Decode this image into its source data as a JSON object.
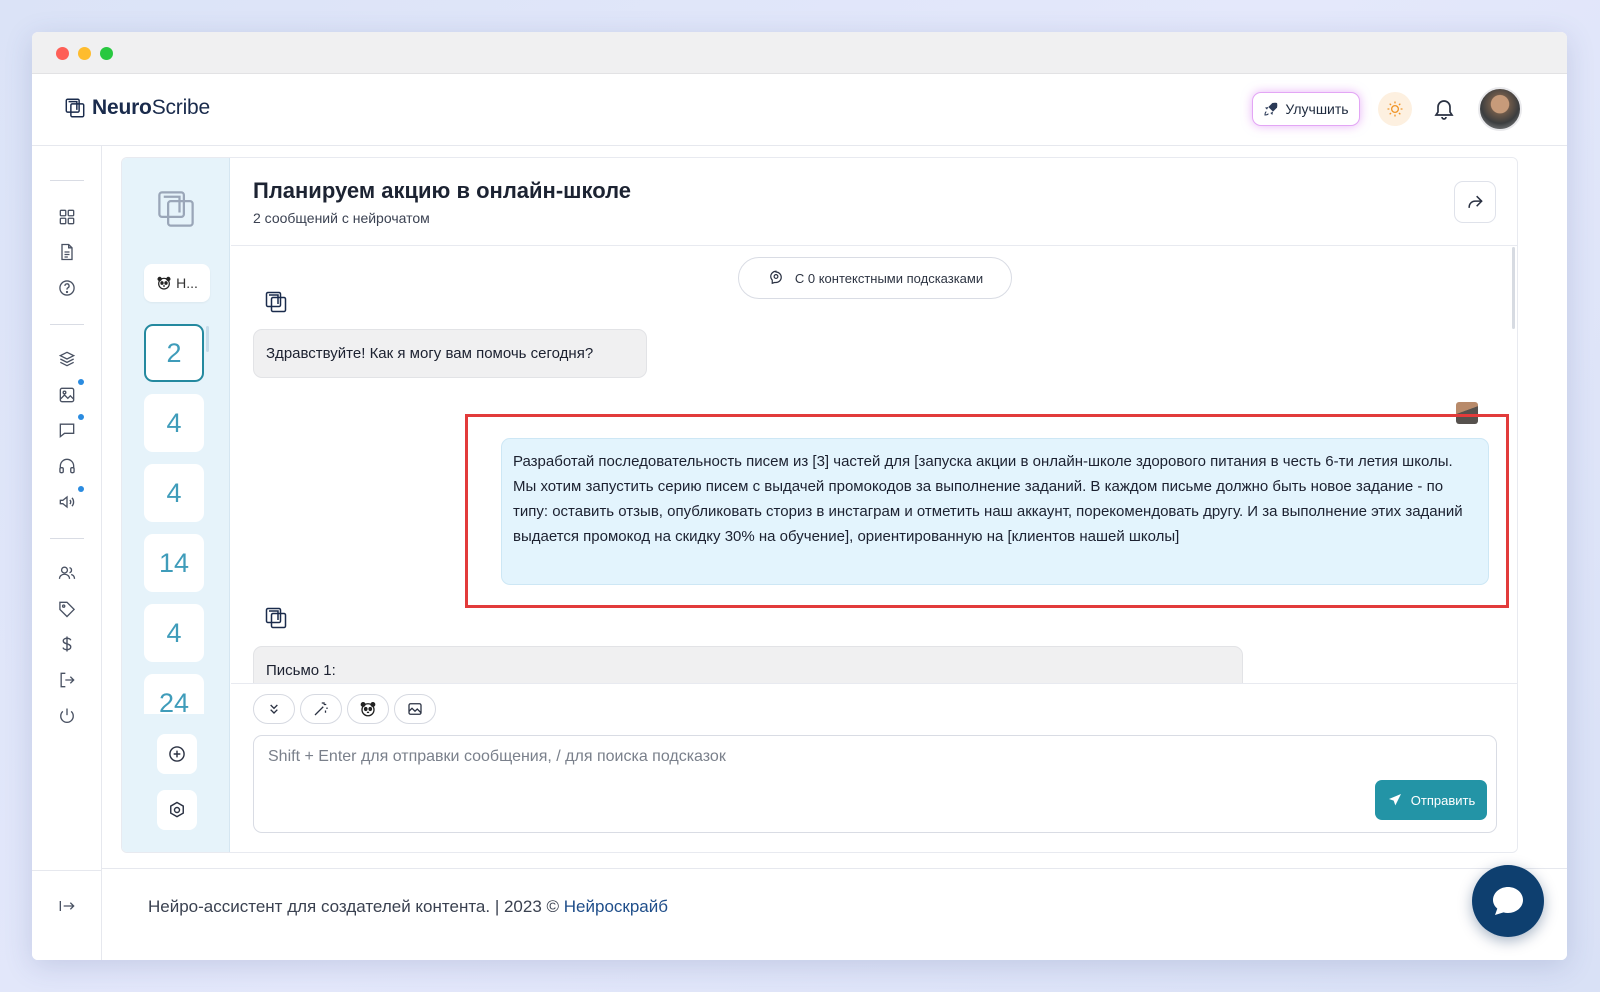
{
  "app": {
    "brand_bold": "Neuro",
    "brand_regular": "Scribe"
  },
  "header": {
    "upgrade_label": "Улучшить",
    "icons": [
      "sun-icon",
      "bell-icon",
      "avatar"
    ]
  },
  "sidebar_icons": [
    "dashboard-icon",
    "document-icon",
    "help-icon",
    "layers-icon",
    "image-icon",
    "chat-icon",
    "headphones-icon",
    "megaphone-icon",
    "users-icon",
    "tag-icon",
    "dollar-icon",
    "logout-icon",
    "power-icon",
    "collapse-icon"
  ],
  "prompt_panel": {
    "selector_label": "Н...",
    "counts": [
      "2",
      "4",
      "4",
      "14",
      "4",
      "24"
    ],
    "active_index": 0
  },
  "chat": {
    "title": "Планируем акцию в онлайн-школе",
    "subtitle": "2 сообщений с нейрочатом",
    "context_pill": "С 0 контекстными подсказками",
    "messages": [
      {
        "role": "bot",
        "text": "Здравствуйте! Как я могу вам помочь сегодня?"
      },
      {
        "role": "user",
        "text": "Разработай последовательность писем из [3] частей для [запуска акции в онлайн-школе здорового питания в честь 6-ти летия школы. Мы хотим запустить серию писем с выдачей промокодов за выполнение заданий. В каждом письме должно быть новое задание - по типу: оставить отзыв, опубликовать сториз в инстаграм и отметить наш аккаунт, порекомендовать другу. И за выполнение этих заданий выдается промокод на скидку 30% на обучение], ориентированную на [клиентов нашей школы]"
      },
      {
        "role": "bot",
        "text": "Письмо 1:"
      }
    ]
  },
  "composer": {
    "placeholder": "Shift + Enter для отправки сообщения, / для поиска подсказок",
    "send_label": "Отправить",
    "tools": [
      "chevrons-down-icon",
      "magic-wand-icon",
      "panda-icon",
      "image-icon"
    ]
  },
  "footer": {
    "text": "Нейро-ассистент для создателей контента.  | 2023 © ",
    "link": "Нейроскрайб"
  },
  "colors": {
    "accent": "#2394a6",
    "brand_dark": "#0e3f6f",
    "highlight": "#e23b3b"
  }
}
